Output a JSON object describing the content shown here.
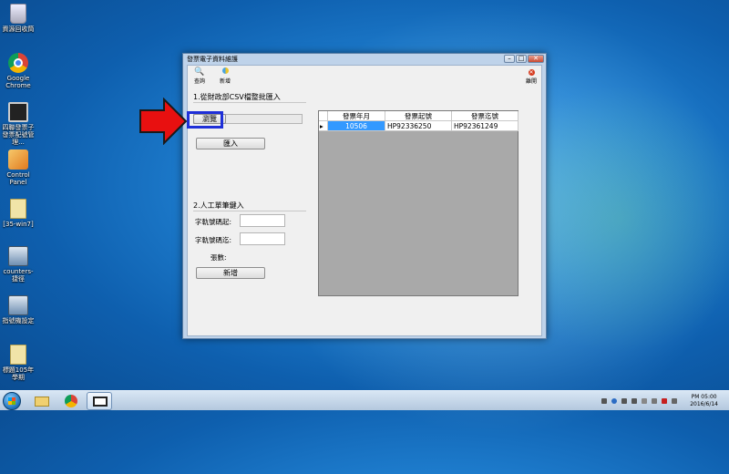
{
  "desktop": {
    "icons": [
      {
        "label": "資源回收筒",
        "icon": "recycle-bin-icon"
      },
      {
        "label": "Google Chrome",
        "icon": "chrome-icon"
      },
      {
        "label": "四聯發票子發票配號管理...",
        "icon": "monitor-app-icon"
      },
      {
        "label": "Control Panel",
        "icon": "control-panel-icon"
      },
      {
        "label": "[35-win7]",
        "icon": "file-icon"
      },
      {
        "label": "counters-捷徑",
        "icon": "app-shortcut-icon"
      },
      {
        "label": "指號機設定",
        "icon": "app-shortcut-icon"
      },
      {
        "label": "標題105年學期",
        "icon": "file-icon"
      }
    ]
  },
  "window": {
    "title": "發票電子資料維護",
    "toolbar": {
      "search_label": "查詢",
      "add_label": "新增",
      "exit_label": "離開"
    },
    "section1_label": "1.從財政部CSV檔整批匯入",
    "browse_label": "瀏覽",
    "import_label": "匯入",
    "section2_label": "2.人工單筆鍵入",
    "start_no_label": "字軌號碼起:",
    "end_no_label": "字軌號碼迄:",
    "count_label": "張數:",
    "add_button_label": "新增",
    "grid": {
      "columns": [
        "發票年月",
        "發票起號",
        "發票迄號"
      ],
      "rows": [
        {
          "indicator": "▸",
          "cells": [
            "10506",
            "HP92336250",
            "HP92361249"
          ]
        }
      ]
    }
  },
  "taskbar": {
    "time": "PM 05:00",
    "date": "2016/6/14"
  },
  "colors": {
    "highlight_border": "#1f2fd8",
    "arrow": "#e81010",
    "selected_cell": "#3399ff"
  }
}
